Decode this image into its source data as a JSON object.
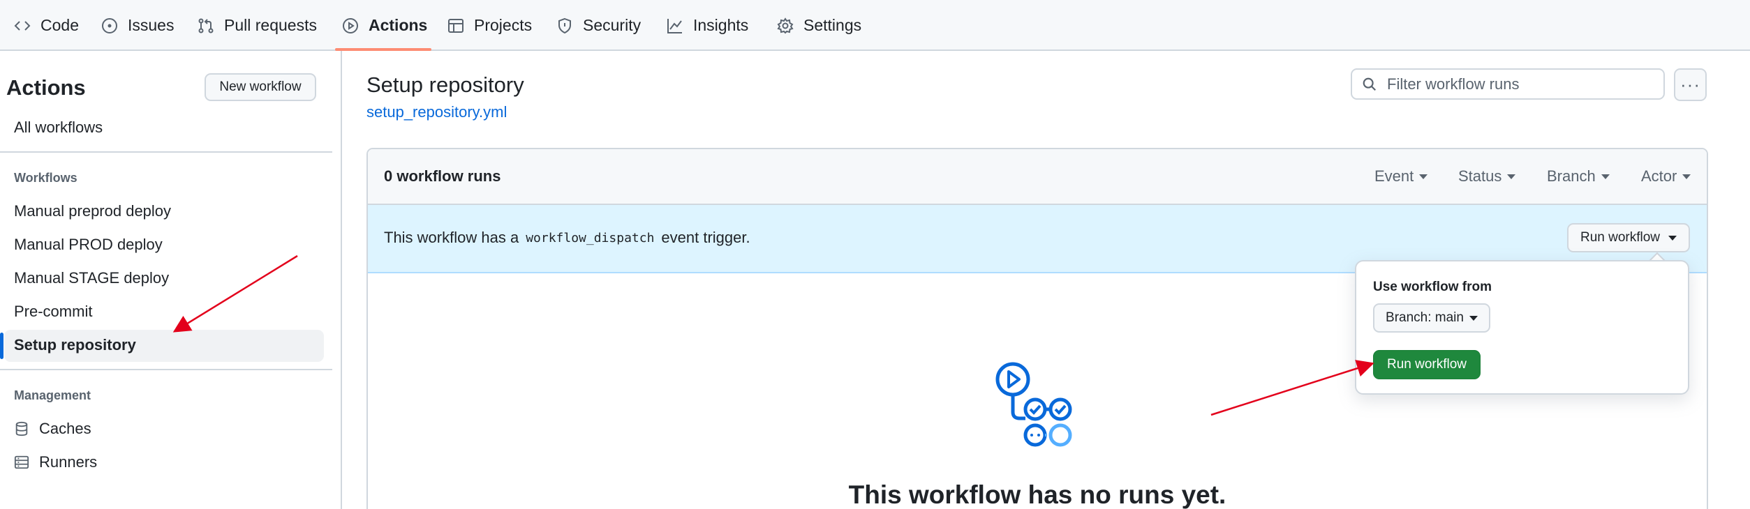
{
  "topnav": {
    "tabs": [
      {
        "label": "Code",
        "icon": "code-icon"
      },
      {
        "label": "Issues",
        "icon": "issue-icon"
      },
      {
        "label": "Pull requests",
        "icon": "pull-request-icon"
      },
      {
        "label": "Actions",
        "icon": "play-icon",
        "active": true
      },
      {
        "label": "Projects",
        "icon": "table-icon"
      },
      {
        "label": "Security",
        "icon": "shield-icon"
      },
      {
        "label": "Insights",
        "icon": "graph-icon"
      },
      {
        "label": "Settings",
        "icon": "gear-icon"
      }
    ],
    "active_color": "#fd8c73"
  },
  "sidebar": {
    "title": "Actions",
    "new_workflow_label": "New workflow",
    "all_workflows_label": "All workflows",
    "workflows_heading": "Workflows",
    "workflows": [
      {
        "label": "Manual preprod deploy"
      },
      {
        "label": "Manual PROD deploy"
      },
      {
        "label": "Manual STAGE deploy"
      },
      {
        "label": "Pre-commit"
      },
      {
        "label": "Setup repository",
        "active": true
      }
    ],
    "management_heading": "Management",
    "management": [
      {
        "label": "Caches",
        "icon": "database-icon"
      },
      {
        "label": "Runners",
        "icon": "server-icon"
      }
    ]
  },
  "main": {
    "title": "Setup repository",
    "file_link": "setup_repository.yml",
    "filter_placeholder": "Filter workflow runs",
    "runs_count": "0 workflow runs",
    "filters": [
      "Event",
      "Status",
      "Branch",
      "Actor"
    ],
    "dispatch_prefix": "This workflow has a",
    "dispatch_code": "workflow_dispatch",
    "dispatch_suffix": "event trigger.",
    "run_workflow_label": "Run workflow",
    "empty_title": "This workflow has no runs yet."
  },
  "popover": {
    "title": "Use workflow from",
    "branch_label": "Branch: main",
    "run_label": "Run workflow",
    "run_color": "#1f883d"
  },
  "annotations": {
    "arrow_color": "#e3001b"
  }
}
